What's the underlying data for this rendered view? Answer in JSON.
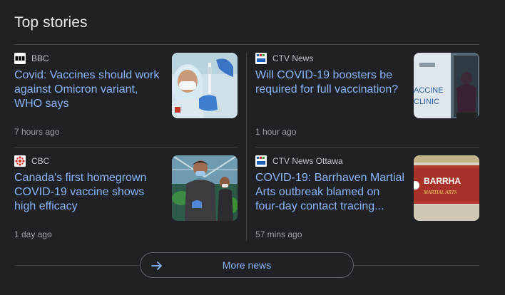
{
  "section": {
    "title": "Top stories"
  },
  "stories": [
    {
      "source": "BBC",
      "headline": "Covid: Vaccines should work against Omicron variant, WHO says",
      "time": "7 hours ago",
      "thumb_alt": "Health worker in PPE preparing a vaccine syringe"
    },
    {
      "source": "CTV News",
      "headline": "Will COVID-19 boosters be required for full vaccination?",
      "time": "1 hour ago",
      "thumb_alt": "Person entering vaccine clinic"
    },
    {
      "source": "CBC",
      "headline": "Canada's first homegrown COVID-19 vaccine shows high efficacy",
      "time": "1 day ago",
      "thumb_alt": "Workers in masks tending plants in a greenhouse"
    },
    {
      "source": "CTV News Ottawa",
      "headline": "COVID-19: Barrhaven Martial Arts outbreak blamed on four-day contact tracing...",
      "time": "57 mins ago",
      "thumb_alt": "Barrhaven Martial Arts storefront sign"
    }
  ],
  "thumb_text": {
    "ctv_sign_1": "ACCINE",
    "ctv_sign_2": "CLINIC",
    "barrhaven_sign_1": "BARRHA",
    "barrhaven_sign_2": "MARTIAL ARTS"
  },
  "more": {
    "label": "More news"
  },
  "colors": {
    "background": "#202124",
    "headline": "#8ab4f8",
    "source": "#bdc1c6",
    "time": "#9aa0a6",
    "divider": "#3c4043"
  }
}
